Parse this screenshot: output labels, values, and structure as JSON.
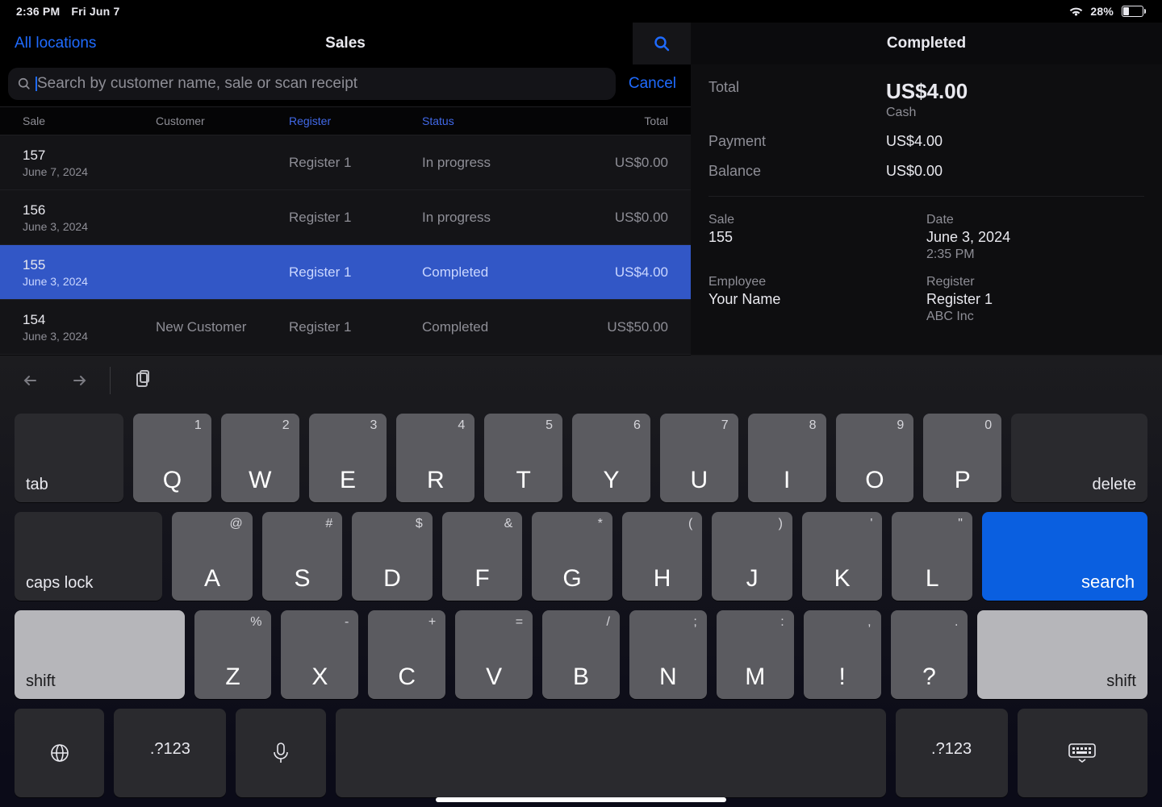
{
  "statusbar": {
    "time": "2:36 PM",
    "date": "Fri Jun 7",
    "battery": "28%"
  },
  "nav": {
    "back": "All locations",
    "title": "Sales"
  },
  "search": {
    "placeholder": "Search by customer name, sale or scan receipt",
    "cancel": "Cancel"
  },
  "columns": {
    "sale": "Sale",
    "customer": "Customer",
    "register": "Register",
    "status": "Status",
    "total": "Total"
  },
  "rows": [
    {
      "id": "157",
      "date": "June 7, 2024",
      "customer": "",
      "register": "Register 1",
      "status": "In progress",
      "total": "US$0.00",
      "selected": false
    },
    {
      "id": "156",
      "date": "June 3, 2024",
      "customer": "",
      "register": "Register 1",
      "status": "In progress",
      "total": "US$0.00",
      "selected": false
    },
    {
      "id": "155",
      "date": "June 3, 2024",
      "customer": "",
      "register": "Register 1",
      "status": "Completed",
      "total": "US$4.00",
      "selected": true
    },
    {
      "id": "154",
      "date": "June 3, 2024",
      "customer": "New Customer",
      "register": "Register 1",
      "status": "Completed",
      "total": "US$50.00",
      "selected": false
    }
  ],
  "detail": {
    "title": "Completed",
    "total_label": "Total",
    "total_value": "US$4.00",
    "total_method": "Cash",
    "payment_label": "Payment",
    "payment_value": "US$4.00",
    "balance_label": "Balance",
    "balance_value": "US$0.00",
    "sale_label": "Sale",
    "sale_value": "155",
    "date_label": "Date",
    "date_value": "June 3, 2024",
    "date_time": "2:35 PM",
    "employee_label": "Employee",
    "employee_value": "Your Name",
    "register_label": "Register",
    "register_value": "Register 1",
    "register_org": "ABC Inc"
  },
  "keyboard": {
    "tab": "tab",
    "delete": "delete",
    "caps": "caps lock",
    "search": "search",
    "shift": "shift",
    "num": ".?123",
    "row1": [
      [
        "Q",
        "1"
      ],
      [
        "W",
        "2"
      ],
      [
        "E",
        "3"
      ],
      [
        "R",
        "4"
      ],
      [
        "T",
        "5"
      ],
      [
        "Y",
        "6"
      ],
      [
        "U",
        "7"
      ],
      [
        "I",
        "8"
      ],
      [
        "O",
        "9"
      ],
      [
        "P",
        "0"
      ]
    ],
    "row2": [
      [
        "A",
        "@"
      ],
      [
        "S",
        "#"
      ],
      [
        "D",
        "$"
      ],
      [
        "F",
        "&"
      ],
      [
        "G",
        "*"
      ],
      [
        "H",
        "("
      ],
      [
        "J",
        ")"
      ],
      [
        "K",
        "'"
      ],
      [
        "L",
        "\""
      ]
    ],
    "row3": [
      [
        "Z",
        "%"
      ],
      [
        "X",
        "-"
      ],
      [
        "C",
        "+"
      ],
      [
        "V",
        "="
      ],
      [
        "B",
        "/"
      ],
      [
        "N",
        ";"
      ],
      [
        "M",
        ":"
      ],
      [
        "!",
        ","
      ],
      [
        "?",
        "."
      ]
    ]
  }
}
